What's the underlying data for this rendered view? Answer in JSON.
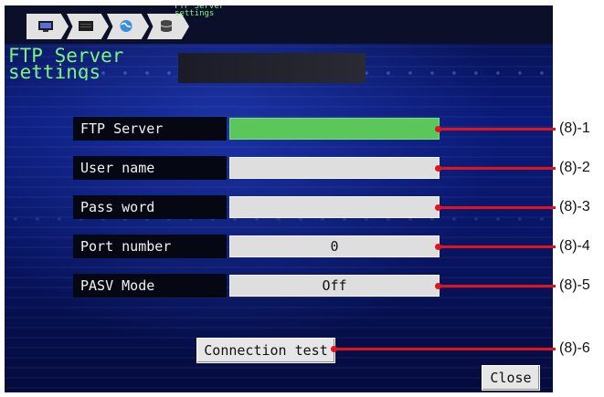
{
  "breadcrumb": {
    "items": [
      {
        "icon": "monitor-icon"
      },
      {
        "icon": "device-icon"
      },
      {
        "icon": "globe-icon"
      },
      {
        "icon": "database-icon"
      }
    ],
    "caption": "FTP Server\nsettings"
  },
  "page": {
    "title": "FTP Server\nsettings"
  },
  "form": {
    "rows": [
      {
        "label": "FTP Server",
        "value": "",
        "callout": "(8)-1"
      },
      {
        "label": "User name",
        "value": "",
        "callout": "(8)-2"
      },
      {
        "label": "Pass word",
        "value": "",
        "callout": "(8)-3"
      },
      {
        "label": "Port number",
        "value": "0",
        "callout": "(8)-4"
      },
      {
        "label": "PASV Mode",
        "value": "Off",
        "callout": "(8)-5"
      }
    ]
  },
  "actions": {
    "connection_test": {
      "label": "Connection test",
      "callout": "(8)-6"
    },
    "close": {
      "label": "Close"
    }
  },
  "colors": {
    "title_green": "#7df27d",
    "field_active": "#5bc65a",
    "callout_red": "#e2141b",
    "background_blue": "#0a1a7a"
  }
}
